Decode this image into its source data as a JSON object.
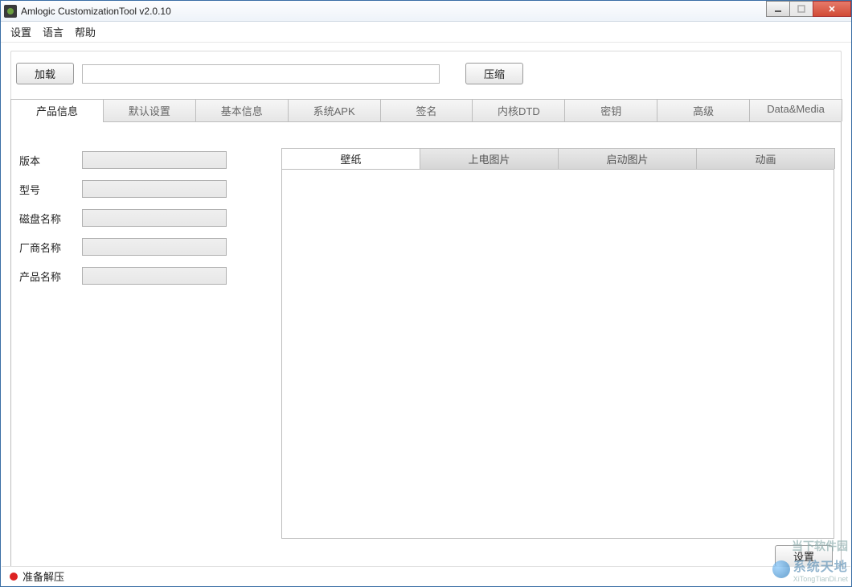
{
  "window": {
    "title": "Amlogic CustomizationTool v2.0.10"
  },
  "menu": {
    "settings": "设置",
    "language": "语言",
    "help": "帮助"
  },
  "toolbar": {
    "load": "加载",
    "path_value": "",
    "compress": "压缩"
  },
  "main_tabs": [
    {
      "label": "产品信息",
      "active": true
    },
    {
      "label": "默认设置",
      "active": false
    },
    {
      "label": "基本信息",
      "active": false
    },
    {
      "label": "系统APK",
      "active": false
    },
    {
      "label": "签名",
      "active": false
    },
    {
      "label": "内核DTD",
      "active": false
    },
    {
      "label": "密钥",
      "active": false
    },
    {
      "label": "高级",
      "active": false
    },
    {
      "label": "Data&Media",
      "active": false
    }
  ],
  "form": {
    "version": {
      "label": "版本",
      "value": ""
    },
    "model": {
      "label": "型号",
      "value": ""
    },
    "disk_name": {
      "label": "磁盘名称",
      "value": ""
    },
    "vendor_name": {
      "label": "厂商名称",
      "value": ""
    },
    "product_name": {
      "label": "产品名称",
      "value": ""
    }
  },
  "inner_tabs": [
    {
      "label": "壁纸",
      "active": true
    },
    {
      "label": "上电图片",
      "active": false
    },
    {
      "label": "启动图片",
      "active": false
    },
    {
      "label": "动画",
      "active": false
    }
  ],
  "buttons": {
    "settings": "设置"
  },
  "status": {
    "text": "准备解压",
    "color": "#d22222"
  },
  "watermark": {
    "line1": "当下软件园",
    "line2": "系统天地",
    "sub": "XiTongTianDi.net"
  }
}
